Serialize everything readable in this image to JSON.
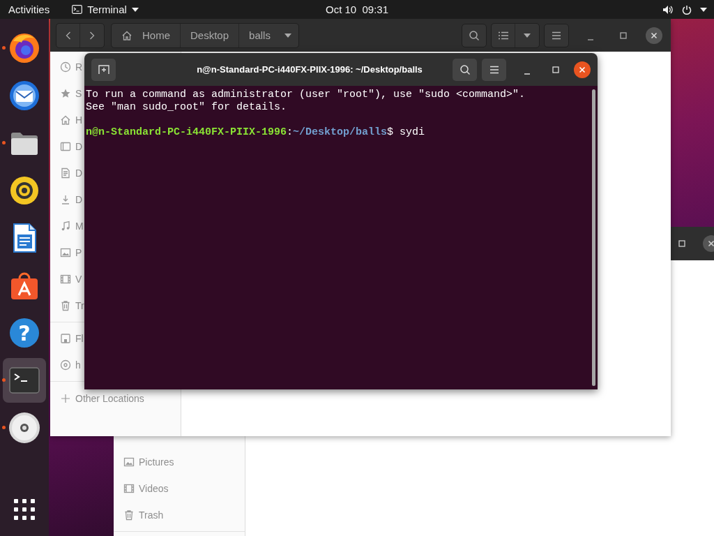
{
  "top_bar": {
    "activities": "Activities",
    "app_menu": "Terminal",
    "clock": "Oct 10  09:31"
  },
  "dock": {
    "items": [
      {
        "kind": "firefox",
        "running": true,
        "selected": false
      },
      {
        "kind": "thunderbird",
        "running": false,
        "selected": false
      },
      {
        "kind": "files",
        "running": true,
        "selected": false
      },
      {
        "kind": "rhythmbox",
        "running": false,
        "selected": false
      },
      {
        "kind": "writer",
        "running": false,
        "selected": false
      },
      {
        "kind": "appcenter",
        "running": false,
        "selected": false
      },
      {
        "kind": "help",
        "running": false,
        "selected": false,
        "glyph": "?"
      },
      {
        "kind": "terminal",
        "running": true,
        "selected": true
      },
      {
        "kind": "dvd",
        "running": true,
        "selected": false
      }
    ],
    "apps_button": {
      "kind": "grid"
    }
  },
  "files_window_back": {
    "sidebar": [
      {
        "kind": "pictures",
        "label": "Pictures"
      },
      {
        "kind": "videos",
        "label": "Videos"
      },
      {
        "kind": "trash",
        "label": "Trash"
      }
    ]
  },
  "files_window": {
    "path": [
      {
        "kind": "home",
        "label": "Home"
      },
      {
        "kind": "folder",
        "label": "Desktop"
      },
      {
        "kind": "current",
        "label": "balls"
      }
    ],
    "places": [
      {
        "kind": "recent",
        "label": "R"
      },
      {
        "kind": "starred",
        "label": "S"
      },
      {
        "kind": "home",
        "label": "H"
      },
      {
        "kind": "desktop",
        "label": "D"
      },
      {
        "kind": "documents",
        "label": "D"
      },
      {
        "kind": "downloads",
        "label": "D"
      },
      {
        "kind": "music",
        "label": "M"
      },
      {
        "kind": "pictures",
        "label": "P"
      },
      {
        "kind": "videos",
        "label": "V"
      },
      {
        "kind": "trash",
        "label": "Tr"
      }
    ],
    "devices": [
      {
        "kind": "floppy",
        "label": "Fl"
      },
      {
        "kind": "disc",
        "label": "h"
      }
    ],
    "other_locations": "Other Locations"
  },
  "terminal": {
    "title": "n@n-Standard-PC-i440FX-PIIX-1996: ~/Desktop/balls",
    "lines": [
      {
        "kind": "output",
        "text": "To run a command as administrator (user \"root\"), use \"sudo <command>\"."
      },
      {
        "kind": "output",
        "text": "See \"man sudo_root\" for details."
      },
      {
        "kind": "blank"
      },
      {
        "kind": "prompt",
        "user": "n@n-Standard-PC-i440FX-PIIX-1996",
        "separator": ":",
        "path": "~/Desktop/balls",
        "symbol": "$",
        "command": " sydi"
      }
    ]
  }
}
